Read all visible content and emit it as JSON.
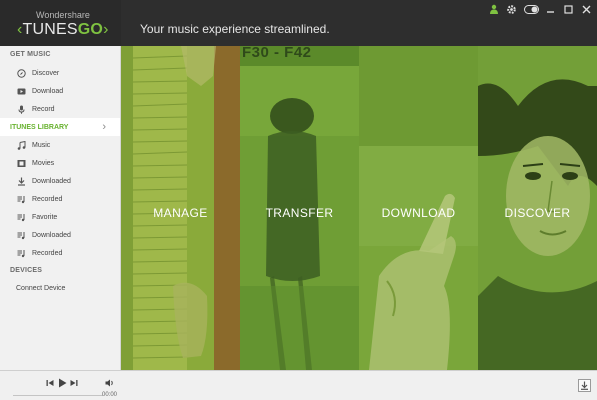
{
  "app": {
    "brand_small": "Wondershare",
    "brand_main": "TUNES",
    "brand_go": "GO",
    "tagline": "Your music experience streamlined."
  },
  "titlebar_icons": [
    "user-icon",
    "gear-icon",
    "toggle-icon",
    "minimize-icon",
    "maximize-icon",
    "close-icon"
  ],
  "sidebar": {
    "get_music_header": "GET MUSIC",
    "get_music": [
      {
        "label": "Discover",
        "icon": "compass-icon"
      },
      {
        "label": "Download",
        "icon": "video-icon"
      },
      {
        "label": "Record",
        "icon": "mic-icon"
      }
    ],
    "library_header": "ITUNES LIBRARY",
    "library": [
      {
        "label": "Music",
        "icon": "music-note-icon"
      },
      {
        "label": "Movies",
        "icon": "film-icon"
      },
      {
        "label": "Downloaded",
        "icon": "download-icon"
      },
      {
        "label": "Recorded",
        "icon": "playlist-icon"
      },
      {
        "label": "Favorite",
        "icon": "playlist-icon"
      },
      {
        "label": "Downloaded",
        "icon": "playlist-icon"
      },
      {
        "label": "Recorded",
        "icon": "playlist-icon"
      }
    ],
    "devices_header": "DEVICES",
    "connect_label": "Connect Device"
  },
  "hero": {
    "panels": [
      {
        "label": "MANAGE",
        "color": "#8aaa3a"
      },
      {
        "label": "TRANSFER",
        "color": "#6f9e35",
        "overlay_text": "F30 - F42"
      },
      {
        "label": "DOWNLOAD",
        "color": "#7aa63a"
      },
      {
        "label": "DISCOVER",
        "color": "#739f38"
      }
    ]
  },
  "player": {
    "time": "00:00"
  },
  "colors": {
    "accent": "#7fc241",
    "titlebar": "#2e2e2e",
    "sidebar": "#f1f1f1"
  }
}
